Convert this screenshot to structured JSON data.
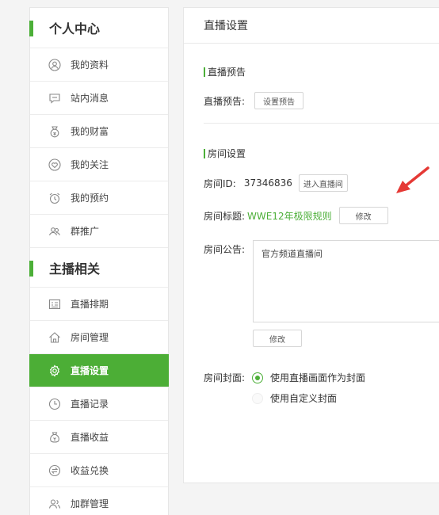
{
  "sidebar": {
    "section1_title": "个人中心",
    "section2_title": "主播相关",
    "items1": [
      {
        "label": "我的资料",
        "icon": "user-icon"
      },
      {
        "label": "站内消息",
        "icon": "message-icon"
      },
      {
        "label": "我的财富",
        "icon": "wealth-icon"
      },
      {
        "label": "我的关注",
        "icon": "heart-icon"
      },
      {
        "label": "我的预约",
        "icon": "alarm-clock-icon"
      },
      {
        "label": "群推广",
        "icon": "group-icon"
      }
    ],
    "items2": [
      {
        "label": "直播排期",
        "icon": "schedule-icon"
      },
      {
        "label": "房间管理",
        "icon": "home-icon"
      },
      {
        "label": "直播设置",
        "icon": "gear-icon",
        "active": true
      },
      {
        "label": "直播记录",
        "icon": "clock-icon"
      },
      {
        "label": "直播收益",
        "icon": "money-bag-icon"
      },
      {
        "label": "收益兑换",
        "icon": "exchange-icon"
      },
      {
        "label": "加群管理",
        "icon": "group-manage-icon"
      }
    ]
  },
  "main": {
    "header": "直播设置",
    "preview": {
      "section_title": "直播预告",
      "label": "直播预告:",
      "button": "设置预告"
    },
    "room": {
      "section_title": "房间设置",
      "id_label": "房间ID:",
      "id_value": "37346836",
      "enter_button": "进入直播间",
      "title_label": "房间标题:",
      "title_value": "WWE12年极限规则",
      "title_edit": "修改",
      "notice_label": "房间公告:",
      "notice_value": "官方频道直播间",
      "notice_edit": "修改",
      "cover_label": "房间封面:",
      "cover_option1": "使用直播画面作为封面",
      "cover_option2": "使用自定义封面",
      "cover_selected": 1
    }
  },
  "colors": {
    "accent": "#4caf38",
    "arrow": "#e53935"
  }
}
